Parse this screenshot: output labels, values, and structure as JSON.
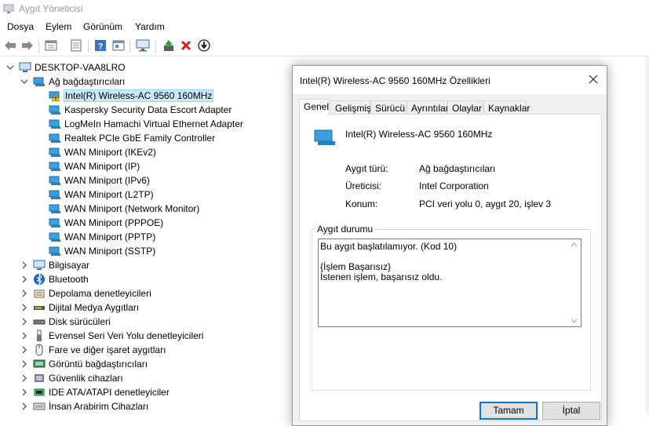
{
  "window": {
    "title": "Aygıt Yöneticisi"
  },
  "menu": [
    "Dosya",
    "Eylem",
    "Görünüm",
    "Yardım"
  ],
  "toolbar": {
    "icons": [
      "back-icon",
      "forward-icon",
      "properties-icon",
      "view-icon",
      "help-icon",
      "details-icon",
      "monitor-icon",
      "update-driver-icon",
      "uninstall-icon",
      "disable-icon"
    ]
  },
  "tree": {
    "root": "DESKTOP-VAA8LRO",
    "network_category": "Ağ bağdaştırıcıları",
    "network_items": [
      "Intel(R) Wireless-AC 9560 160MHz",
      "Kaspersky Security Data Escort Adapter",
      "LogMeIn Hamachi Virtual Ethernet Adapter",
      "Realtek PCIe GbE Family Controller",
      "WAN Miniport (IKEv2)",
      "WAN Miniport (IP)",
      "WAN Miniport (IPv6)",
      "WAN Miniport (L2TP)",
      "WAN Miniport (Network Monitor)",
      "WAN Miniport (PPPOE)",
      "WAN Miniport (PPTP)",
      "WAN Miniport (SSTP)"
    ],
    "categories": [
      "Bilgisayar",
      "Bluetooth",
      "Depolama denetleyicileri",
      "Dijital Medya Aygıtları",
      "Disk sürücüleri",
      "Evrensel Seri Veri Yolu denetleyicileri",
      "Fare ve diğer işaret aygıtları",
      "Görüntü bağdaştırıcıları",
      "Güvenlik cihazları",
      "IDE ATA/ATAPI denetleyiciler",
      "İnsan Arabirim Cihazları"
    ]
  },
  "dialog": {
    "title": "Intel(R) Wireless-AC 9560 160MHz Özellikleri",
    "tabs": [
      "Genel",
      "Gelişmiş",
      "Sürücü",
      "Ayrıntılar",
      "Olaylar",
      "Kaynaklar"
    ],
    "device_name": "Intel(R) Wireless-AC 9560 160MHz",
    "props": [
      {
        "label": "Aygıt türü:",
        "value": "Ağ bağdaştırıcıları"
      },
      {
        "label": "Üreticisi:",
        "value": "Intel Corporation"
      },
      {
        "label": "Konum:",
        "value": "PCI veri yolu 0, aygıt 20, işlev 3"
      }
    ],
    "status_group": "Aygıt durumu",
    "status_lines": [
      "Bu aygıt başlatılamıyor. (Kod 10)",
      "",
      "{İşlem Başarısız}",
      "İstenen işlem, başarısız oldu."
    ],
    "ok_label": "Tamam",
    "cancel_label": "İptal"
  }
}
